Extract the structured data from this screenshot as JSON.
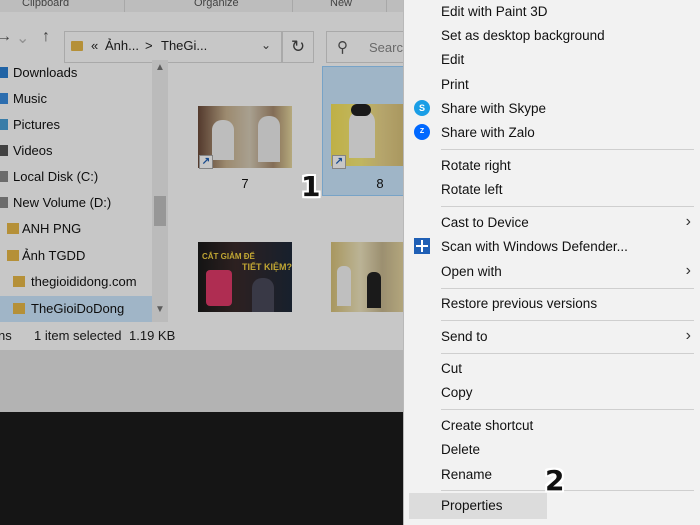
{
  "ribbon": {
    "groups": [
      "Clipboard",
      "Organize",
      "New"
    ]
  },
  "navbar": {
    "back": "←",
    "forward": "→",
    "up": "↑",
    "address_parts": [
      "«",
      "Ảnh...",
      ">",
      "TheGi...",
      "⌄"
    ],
    "refresh": "↻",
    "search_icon": "search-icon",
    "search_placeholder": "Search"
  },
  "sidebar": {
    "items": [
      {
        "label": "Downloads",
        "icon": "download-icon"
      },
      {
        "label": "Music",
        "icon": "music-icon"
      },
      {
        "label": "Pictures",
        "icon": "pictures-icon"
      },
      {
        "label": "Videos",
        "icon": "videos-icon"
      },
      {
        "label": "Local Disk (C:)",
        "icon": "disk-icon"
      },
      {
        "label": "New Volume (D:)",
        "icon": "disk-icon"
      },
      {
        "label": "ANH PNG",
        "icon": "folder-icon"
      },
      {
        "label": "Ảnh TGDD",
        "icon": "folder-icon"
      },
      {
        "label": "thegioididong.com",
        "icon": "folder-icon"
      },
      {
        "label": "TheGioiDoDong",
        "icon": "folder-icon",
        "selected": true
      }
    ]
  },
  "files": [
    {
      "caption": "7"
    },
    {
      "caption": "8",
      "selected": true
    },
    {
      "caption": "",
      "overlay_text_1": "CẮT GIẢM ĐỂ",
      "overlay_text_2": "TIẾT KIỆM?"
    },
    {
      "caption": ""
    }
  ],
  "status": {
    "left": "ns",
    "selected": "1 item selected",
    "size": "1.19 KB"
  },
  "context_menu": {
    "items": [
      {
        "label": "Edit with Paint 3D"
      },
      {
        "label": "Set as desktop background"
      },
      {
        "label": "Edit"
      },
      {
        "label": "Print"
      },
      {
        "label": "Share with Skype",
        "icon": "skype-icon"
      },
      {
        "label": "Share with Zalo",
        "icon": "zalo-icon"
      },
      {
        "label": "Rotate right"
      },
      {
        "label": "Rotate left"
      },
      {
        "label": "Cast to Device",
        "submenu": true
      },
      {
        "label": "Scan with Windows Defender...",
        "icon": "defender-shield-icon"
      },
      {
        "label": "Open with",
        "submenu": true
      },
      {
        "label": "Restore previous versions"
      },
      {
        "label": "Send to",
        "submenu": true
      },
      {
        "label": "Cut"
      },
      {
        "label": "Copy"
      },
      {
        "label": "Create shortcut"
      },
      {
        "label": "Delete"
      },
      {
        "label": "Rename"
      },
      {
        "label": "Properties",
        "highlighted": true
      }
    ],
    "submenu_arrow": "›"
  },
  "annotations": {
    "step1": "1",
    "step2": "2"
  },
  "colors": {
    "selection": "#cce8ff",
    "menu_bg": "#f2f2f2",
    "skype": "#1a9ee6",
    "zalo": "#0068ff",
    "defender": "#1f5fb5"
  }
}
